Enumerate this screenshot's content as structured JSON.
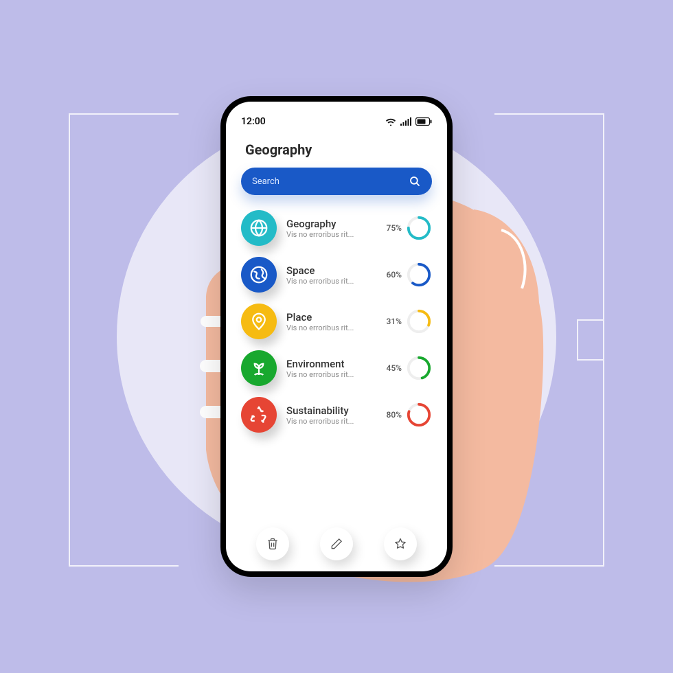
{
  "status": {
    "time": "12:00"
  },
  "header": {
    "title": "Geography"
  },
  "search": {
    "placeholder": "Search"
  },
  "list": {
    "items": [
      {
        "title": "Geography",
        "subtitle": "Vis no erroribus rit...",
        "progress": 75,
        "color": "#23bbc7",
        "icon": "globe"
      },
      {
        "title": "Space",
        "subtitle": "Vis no erroribus rit...",
        "progress": 60,
        "color": "#1959c7",
        "icon": "earth"
      },
      {
        "title": "Place",
        "subtitle": "Vis no erroribus rit...",
        "progress": 31,
        "color": "#f6bb12",
        "icon": "pin"
      },
      {
        "title": "Environment",
        "subtitle": "Vis no erroribus rit...",
        "progress": 45,
        "color": "#18a82e",
        "icon": "plant"
      },
      {
        "title": "Sustainability",
        "subtitle": "Vis no erroribus rit...",
        "progress": 80,
        "color": "#e64534",
        "icon": "recycle"
      }
    ]
  },
  "actions": {
    "trash": "trash-icon",
    "edit": "pencil-icon",
    "star": "star-icon"
  }
}
